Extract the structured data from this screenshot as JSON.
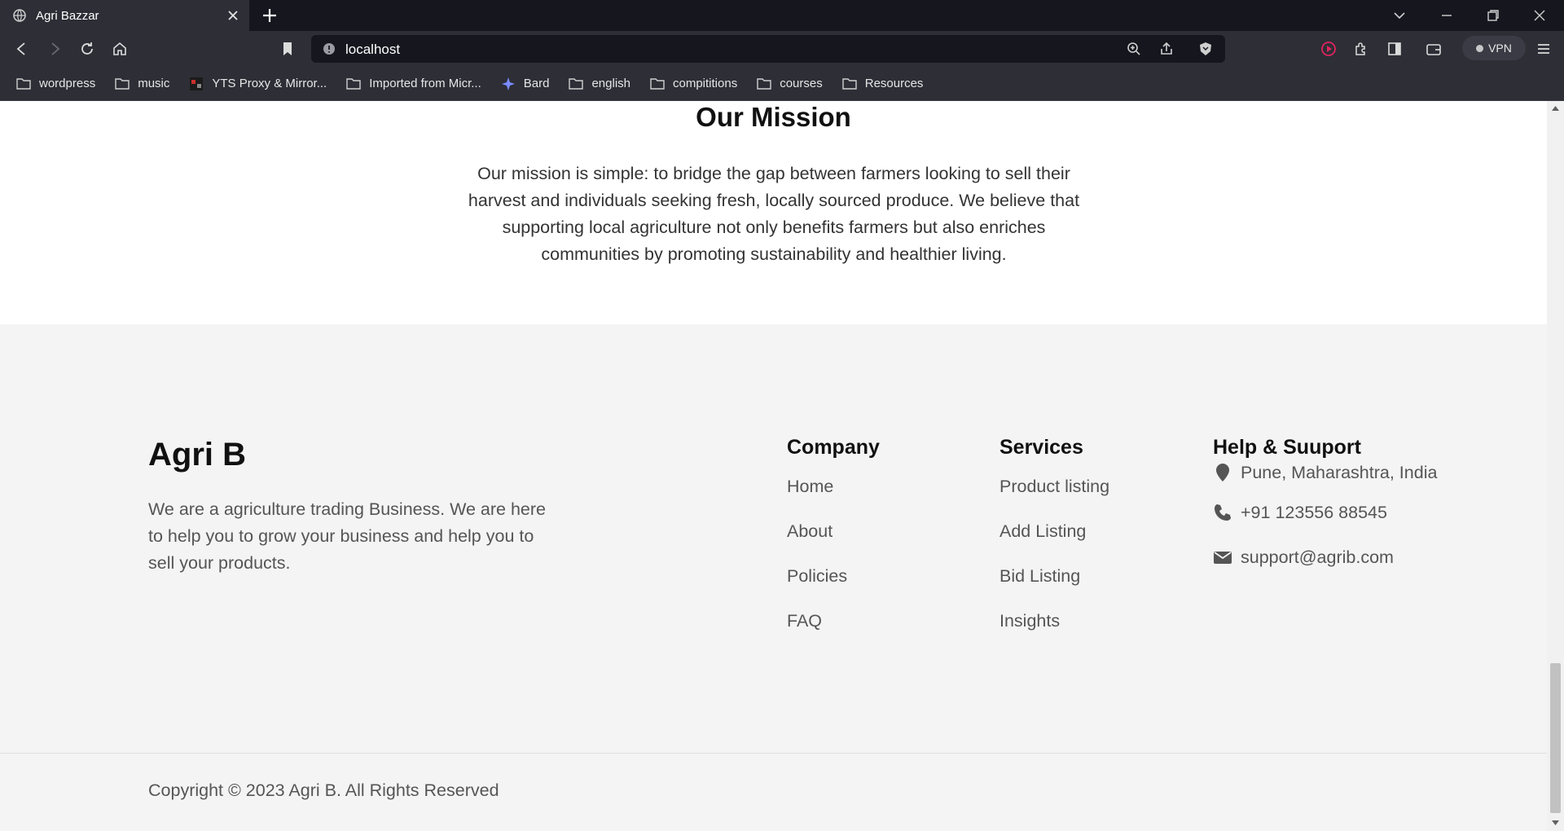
{
  "browser": {
    "tab_title": "Agri Bazzar",
    "url": "localhost",
    "vpn_label": "VPN",
    "bookmarks": [
      "wordpress",
      "music",
      "YTS Proxy & Mirror...",
      "Imported from Micr...",
      "Bard",
      "english",
      "compititions",
      "courses",
      "Resources"
    ]
  },
  "mission": {
    "title": "Our Mission",
    "text": "Our mission is simple: to bridge the gap between farmers looking to sell their harvest and individuals seeking fresh, locally sourced produce. We believe that supporting local agriculture not only benefits farmers but also enriches communities by promoting sustainability and healthier living."
  },
  "footer": {
    "brand": "Agri B",
    "about": "We are a agriculture trading Business. We are here to help you to grow your business and help you to sell your products.",
    "company": {
      "title": "Company",
      "links": [
        "Home",
        "About",
        "Policies",
        "FAQ"
      ]
    },
    "services": {
      "title": "Services",
      "links": [
        "Product listing",
        "Add Listing",
        "Bid Listing",
        "Insights"
      ]
    },
    "help": {
      "title": "Help & Suuport",
      "address": "Pune, Maharashtra, India",
      "phone": "+91 123556 88545",
      "email": "support@agrib.com"
    },
    "copyright": "Copyright © 2023 Agri B. All Rights Reserved"
  }
}
